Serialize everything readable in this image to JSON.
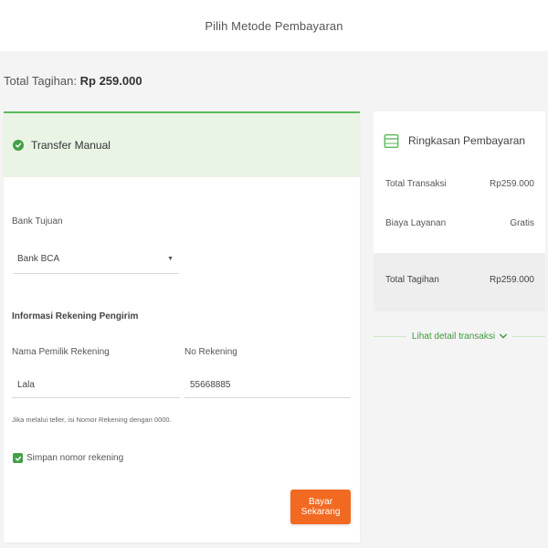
{
  "header": {
    "title": "Pilih Metode Pembayaran"
  },
  "total": {
    "label": "Total Tagihan:",
    "amount": "Rp 259.000"
  },
  "method": {
    "label": "Transfer Manual"
  },
  "form": {
    "bank_label": "Bank Tujuan",
    "bank_value": "Bank BCA",
    "sender_section": "Informasi Rekening Pengirim",
    "name_label": "Nama Pemilik Rekening",
    "name_value": "Lala",
    "account_label": "No Rekening",
    "account_value": "55668885",
    "hint": "Jika melalui teller, isi Nomor Rekening dengan 0000.",
    "save_label": "Simpan nomor rekening",
    "save_checked": true,
    "pay_button": "Bayar Sekarang"
  },
  "summary": {
    "title": "Ringkasan Pembayaran",
    "rows": [
      {
        "label": "Total Transaksi",
        "currency": "Rp",
        "value": "259.000"
      },
      {
        "label": "Biaya Layanan",
        "currency": "",
        "value": "Gratis"
      }
    ],
    "total": {
      "label": "Total Tagihan",
      "currency": "Rp",
      "value": "259.000"
    },
    "detail_link": "Lihat detail transaksi"
  },
  "colors": {
    "accent_green": "#43a047",
    "method_bg": "#e9f4e5",
    "button_orange": "#f26a21"
  },
  "icons": {
    "method_check": "check-circle-icon",
    "summary": "receipt-icon",
    "detail_chevron": "chevron-down-icon",
    "select_caret": "caret-down-icon",
    "checkbox": "checkmark-icon"
  }
}
